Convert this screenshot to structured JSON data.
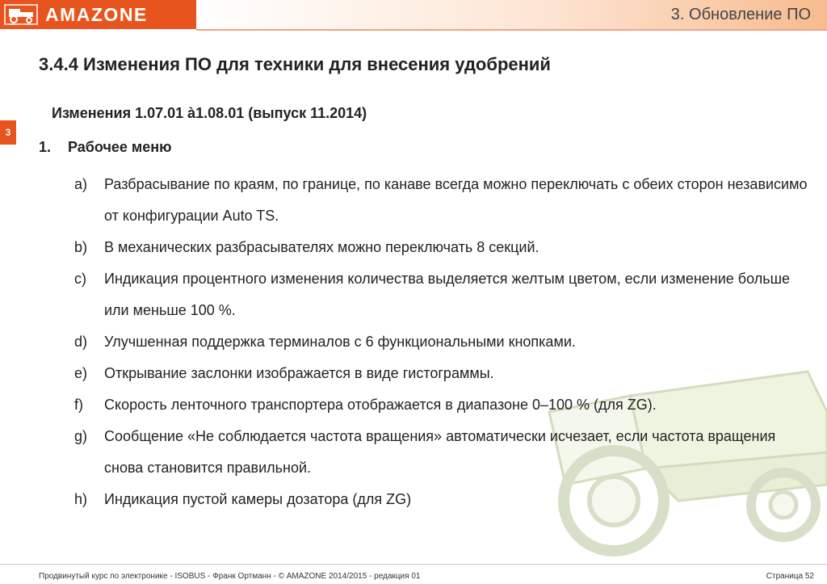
{
  "header": {
    "logo_text": "AMAZONE",
    "section_title": "3.  Обновление ПО"
  },
  "chapter_tab": "3",
  "content": {
    "title": "3.4.4 Изменения ПО для техники для внесения удобрений",
    "subtitle": "Изменения 1.07.01 à1.08.01 (выпуск 11.2014)",
    "list_number": "1.",
    "list_heading": "Рабочее меню",
    "items": [
      {
        "letter": "a)",
        "text": "Разбрасывание по краям, по границе, по канаве всегда можно переключать с обеих сторон независимо от конфигурации Auto TS."
      },
      {
        "letter": "b)",
        "text": "В механических разбрасывателях можно переключать 8 секций."
      },
      {
        "letter": "c)",
        "text": "Индикация процентного изменения количества выделяется желтым цветом, если изменение больше или меньше 100 %."
      },
      {
        "letter": "d)",
        "text": "Улучшенная поддержка терминалов с 6 функциональными кнопками."
      },
      {
        "letter": "e)",
        "text": "Открывание заслонки изображается в виде гистограммы."
      },
      {
        "letter": "f)",
        "text": "Скорость ленточного транспортера отображается в диапазоне 0–100 % (для ZG)."
      },
      {
        "letter": "g)",
        "text": "Сообщение «Не соблюдается частота вращения» автоматически исчезает, если частота вращения снова становится правильной."
      },
      {
        "letter": "h)",
        "text": "Индикация пустой камеры дозатора (для ZG)"
      }
    ]
  },
  "footer": {
    "left": "Продвинутый курс по электронике - ISOBUS - Франк Ортманн - © AMAZONE 2014/2015 - редакция 01",
    "right": "Страница 52"
  },
  "colors": {
    "brand": "#e8541d",
    "text": "#222222"
  },
  "icons": {
    "logo": "amazone-tractor-logo-icon",
    "background": "fertilizer-spreader-illustration"
  }
}
